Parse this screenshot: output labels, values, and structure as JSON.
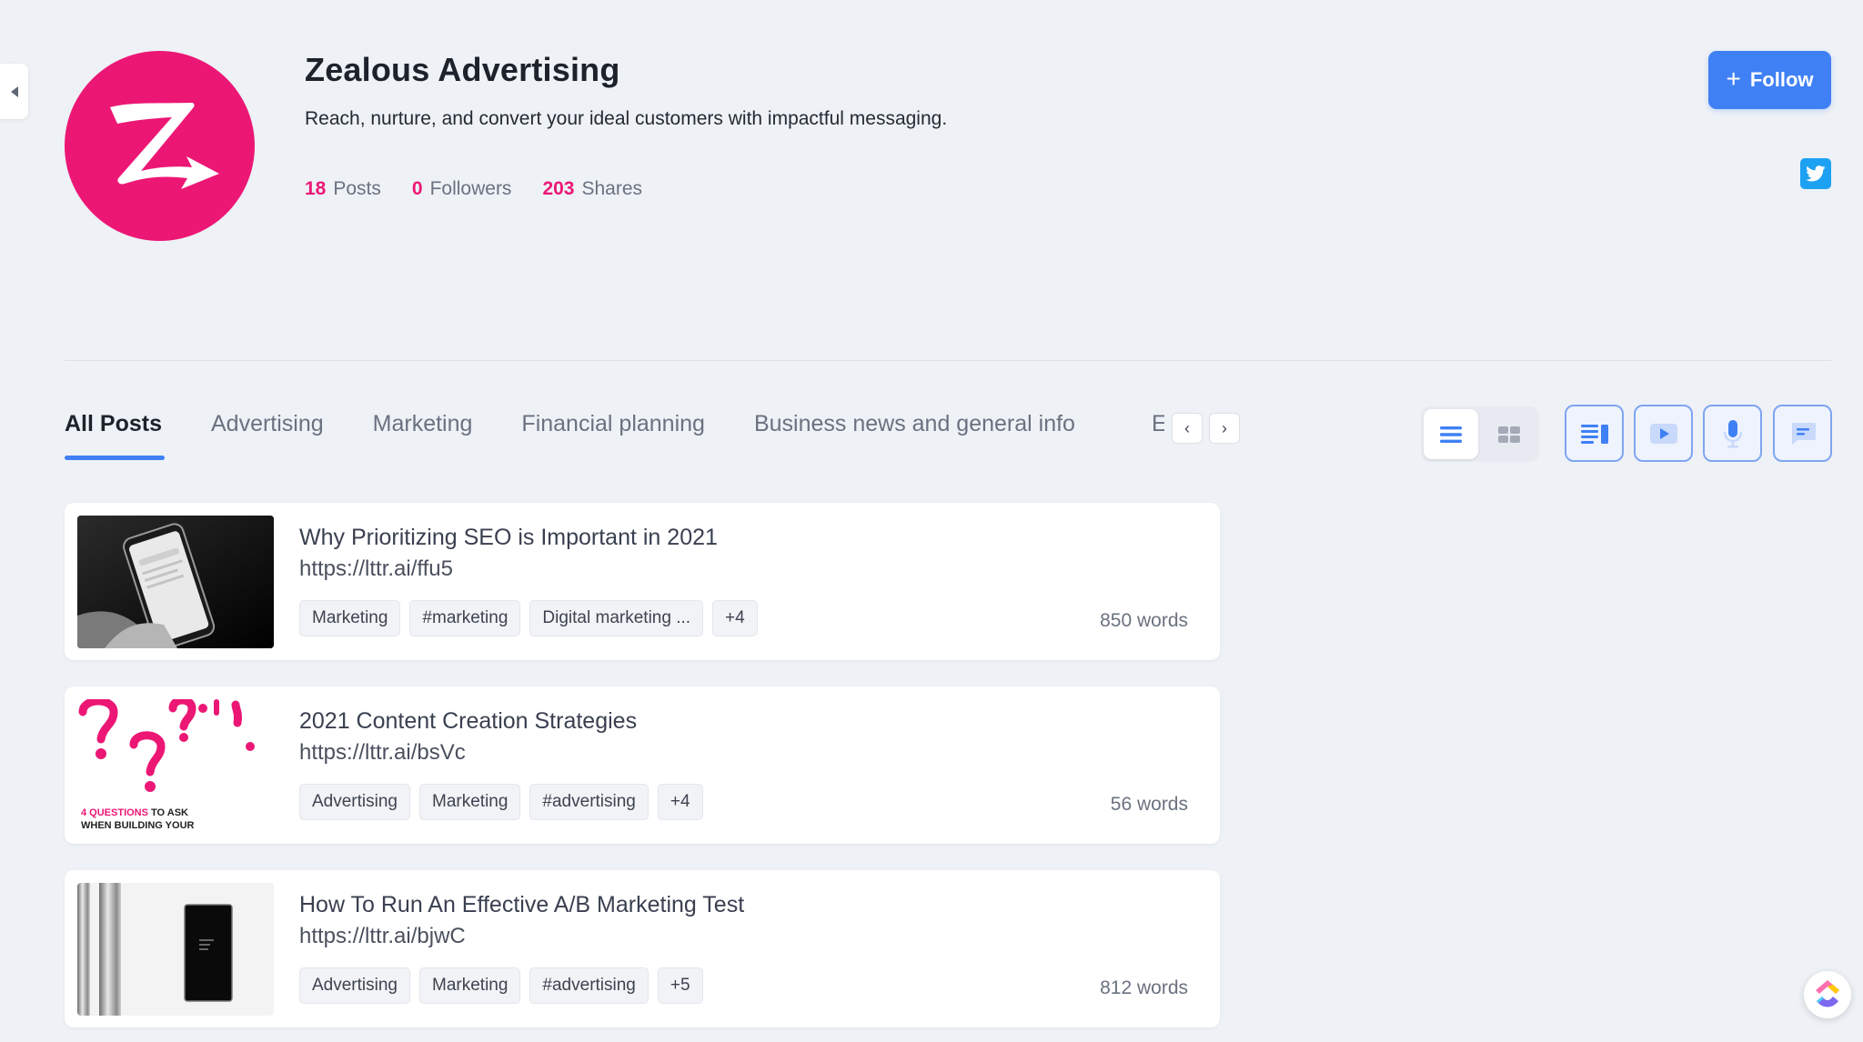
{
  "profile": {
    "name": "Zealous Advertising",
    "tagline": "Reach, nurture, and convert your ideal customers with impactful messaging.",
    "logo_letter": "Z",
    "stats": [
      {
        "value": "18",
        "label": "Posts"
      },
      {
        "value": "0",
        "label": "Followers"
      },
      {
        "value": "203",
        "label": "Shares"
      }
    ],
    "follow_label": "Follow",
    "social_icon": "twitter-icon"
  },
  "tabs": {
    "items": [
      "All Posts",
      "Advertising",
      "Marketing",
      "Financial planning",
      "Business news and general info"
    ],
    "overflow_letter": "E",
    "prev_symbol": "‹",
    "next_symbol": "›"
  },
  "view": {
    "list_icon": "list-view-icon",
    "grid_icon": "grid-view-icon"
  },
  "filters": [
    "article-icon",
    "video-icon",
    "microphone-icon",
    "comment-icon"
  ],
  "posts": [
    {
      "title": "Why Prioritizing SEO is Important in 2021",
      "url": "https://lttr.ai/ffu5",
      "tags": [
        "Marketing",
        "#marketing",
        "Digital marketing ..."
      ],
      "more": "+4",
      "words": "850 words"
    },
    {
      "title": "2021 Content Creation Strategies",
      "url": "https://lttr.ai/bsVc",
      "tags": [
        "Advertising",
        "Marketing",
        "#advertising"
      ],
      "more": "+4",
      "words": "56 words",
      "thumb_caption_highlight": "4 QUESTIONS",
      "thumb_caption_rest": " TO ASK",
      "thumb_caption_line2": "WHEN BUILDING YOUR"
    },
    {
      "title": "How To Run An Effective A/B Marketing Test",
      "url": "https://lttr.ai/bjwC",
      "tags": [
        "Advertising",
        "Marketing",
        "#advertising"
      ],
      "more": "+5",
      "words": "812 words"
    }
  ],
  "colors": {
    "brand": "#ec1775",
    "accent": "#3f80f5",
    "twitter": "#1da1f2",
    "background": "#eef1f6"
  }
}
